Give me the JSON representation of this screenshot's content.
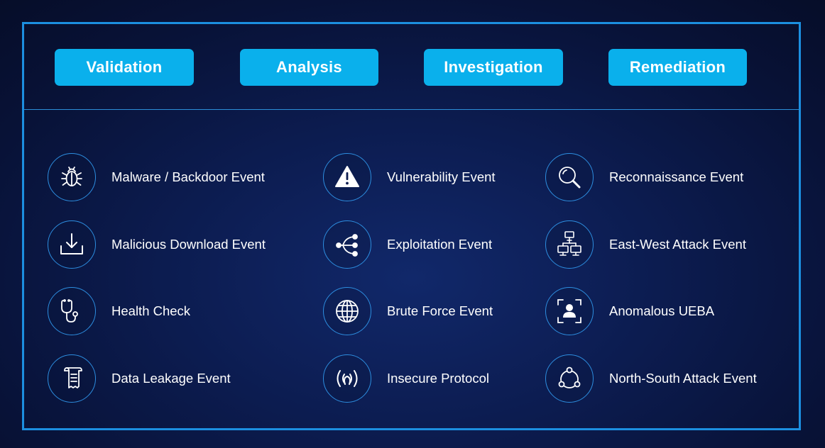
{
  "tabs": [
    {
      "label": "Validation"
    },
    {
      "label": "Analysis"
    },
    {
      "label": "Investigation"
    },
    {
      "label": "Remediation"
    }
  ],
  "events": {
    "col1": [
      {
        "label": "Malware / Backdoor Event",
        "icon": "bug-icon"
      },
      {
        "label": "Malicious Download Event",
        "icon": "download-icon"
      },
      {
        "label": "Health Check",
        "icon": "stethoscope-icon"
      },
      {
        "label": "Data Leakage Event",
        "icon": "receipt-icon"
      }
    ],
    "col2": [
      {
        "label": "Vulnerability Event",
        "icon": "warning-icon"
      },
      {
        "label": "Exploitation Event",
        "icon": "share-icon"
      },
      {
        "label": "Brute Force Event",
        "icon": "globe-icon"
      },
      {
        "label": "Insecure Protocol",
        "icon": "broadcast-icon"
      }
    ],
    "col3": [
      {
        "label": "Reconnaissance Event",
        "icon": "magnifier-icon"
      },
      {
        "label": "East-West Attack Event",
        "icon": "network-icon"
      },
      {
        "label": "Anomalous UEBA",
        "icon": "user-focus-icon"
      },
      {
        "label": "North-South Attack Event",
        "icon": "cycle-icon"
      }
    ]
  },
  "colors": {
    "accent": "#0ab0ec",
    "border": "#1c8fe0",
    "background": "#0c1c50"
  }
}
